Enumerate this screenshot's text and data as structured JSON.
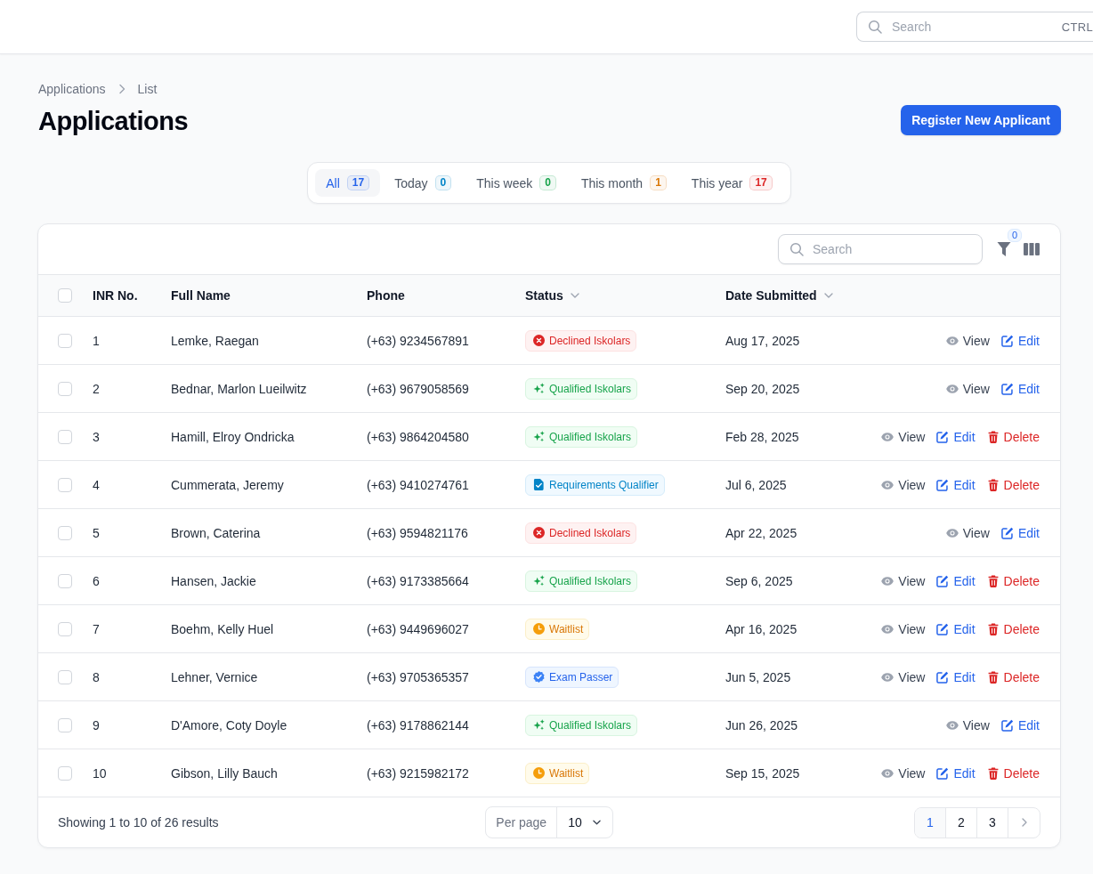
{
  "topbar": {
    "search": {
      "placeholder": "Search",
      "shortcut": "CTRL"
    }
  },
  "breadcrumb": [
    "Applications",
    "List"
  ],
  "title": "Applications",
  "primary_button": "Register New Applicant",
  "tabs": [
    {
      "label": "All",
      "count": "17",
      "color": "#2563eb",
      "selected": true
    },
    {
      "label": "Today",
      "count": "0",
      "color": "#0284c7",
      "selected": false
    },
    {
      "label": "This week",
      "count": "0",
      "color": "#16a34a",
      "selected": false
    },
    {
      "label": "This month",
      "count": "1",
      "color": "#d97706",
      "selected": false
    },
    {
      "label": "This year",
      "count": "17",
      "color": "#dc2626",
      "selected": false
    }
  ],
  "table": {
    "search": {
      "placeholder": "Search"
    },
    "filter_count": "0",
    "select_all": {
      "checked": false
    },
    "columns": [
      {
        "label": "INR No.",
        "sortable": false
      },
      {
        "label": "Full Name",
        "sortable": false
      },
      {
        "label": "Phone",
        "sortable": false
      },
      {
        "label": "Status",
        "sortable": true
      },
      {
        "label": "Date Submitted",
        "sortable": true
      }
    ],
    "rows": [
      {
        "checked": false,
        "inr": "1",
        "name": "Lemke, Raegan",
        "phone": "(+63) 9234567891",
        "status": {
          "kind": "declined",
          "label": "Declined Iskolars"
        },
        "date": "Aug 17, 2025",
        "actions": [
          {
            "kind": "view",
            "label": "View"
          },
          {
            "kind": "edit",
            "label": "Edit"
          }
        ]
      },
      {
        "checked": false,
        "inr": "2",
        "name": "Bednar, Marlon Lueilwitz",
        "phone": "(+63) 9679058569",
        "status": {
          "kind": "qualified",
          "label": "Qualified Iskolars"
        },
        "date": "Sep 20, 2025",
        "actions": [
          {
            "kind": "view",
            "label": "View"
          },
          {
            "kind": "edit",
            "label": "Edit"
          }
        ]
      },
      {
        "checked": false,
        "inr": "3",
        "name": "Hamill, Elroy Ondricka",
        "phone": "(+63) 9864204580",
        "status": {
          "kind": "qualified",
          "label": "Qualified Iskolars"
        },
        "date": "Feb 28, 2025",
        "actions": [
          {
            "kind": "view",
            "label": "View"
          },
          {
            "kind": "edit",
            "label": "Edit"
          },
          {
            "kind": "delete",
            "label": "Delete"
          }
        ]
      },
      {
        "checked": false,
        "inr": "4",
        "name": "Cummerata, Jeremy",
        "phone": "(+63) 9410274761",
        "status": {
          "kind": "requirements",
          "label": "Requirements Qualifier"
        },
        "date": "Jul 6, 2025",
        "actions": [
          {
            "kind": "view",
            "label": "View"
          },
          {
            "kind": "edit",
            "label": "Edit"
          },
          {
            "kind": "delete",
            "label": "Delete"
          }
        ]
      },
      {
        "checked": false,
        "inr": "5",
        "name": "Brown, Caterina",
        "phone": "(+63) 9594821176",
        "status": {
          "kind": "declined",
          "label": "Declined Iskolars"
        },
        "date": "Apr 22, 2025",
        "actions": [
          {
            "kind": "view",
            "label": "View"
          },
          {
            "kind": "edit",
            "label": "Edit"
          }
        ]
      },
      {
        "checked": false,
        "inr": "6",
        "name": "Hansen, Jackie",
        "phone": "(+63) 9173385664",
        "status": {
          "kind": "qualified",
          "label": "Qualified Iskolars"
        },
        "date": "Sep 6, 2025",
        "actions": [
          {
            "kind": "view",
            "label": "View"
          },
          {
            "kind": "edit",
            "label": "Edit"
          },
          {
            "kind": "delete",
            "label": "Delete"
          }
        ]
      },
      {
        "checked": false,
        "inr": "7",
        "name": "Boehm, Kelly Huel",
        "phone": "(+63) 9449696027",
        "status": {
          "kind": "waitlist",
          "label": "Waitlist"
        },
        "date": "Apr 16, 2025",
        "actions": [
          {
            "kind": "view",
            "label": "View"
          },
          {
            "kind": "edit",
            "label": "Edit"
          },
          {
            "kind": "delete",
            "label": "Delete"
          }
        ]
      },
      {
        "checked": false,
        "inr": "8",
        "name": "Lehner, Vernice",
        "phone": "(+63) 9705365357",
        "status": {
          "kind": "exam",
          "label": "Exam Passer"
        },
        "date": "Jun 5, 2025",
        "actions": [
          {
            "kind": "view",
            "label": "View"
          },
          {
            "kind": "edit",
            "label": "Edit"
          },
          {
            "kind": "delete",
            "label": "Delete"
          }
        ]
      },
      {
        "checked": false,
        "inr": "9",
        "name": "D'Amore, Coty Doyle",
        "phone": "(+63) 9178862144",
        "status": {
          "kind": "qualified",
          "label": "Qualified Iskolars"
        },
        "date": "Jun 26, 2025",
        "actions": [
          {
            "kind": "view",
            "label": "View"
          },
          {
            "kind": "edit",
            "label": "Edit"
          }
        ]
      },
      {
        "checked": false,
        "inr": "10",
        "name": "Gibson, Lilly Bauch",
        "phone": "(+63) 9215982172",
        "status": {
          "kind": "waitlist",
          "label": "Waitlist"
        },
        "date": "Sep 15, 2025",
        "actions": [
          {
            "kind": "view",
            "label": "View"
          },
          {
            "kind": "edit",
            "label": "Edit"
          },
          {
            "kind": "delete",
            "label": "Delete"
          }
        ]
      }
    ]
  },
  "footer": {
    "summary": "Showing 1 to 10 of 26 results",
    "per_page": {
      "label": "Per page",
      "value": "10"
    },
    "pages": [
      {
        "label": "1",
        "selected": true
      },
      {
        "label": "2",
        "selected": false
      },
      {
        "label": "3",
        "selected": false
      }
    ]
  }
}
